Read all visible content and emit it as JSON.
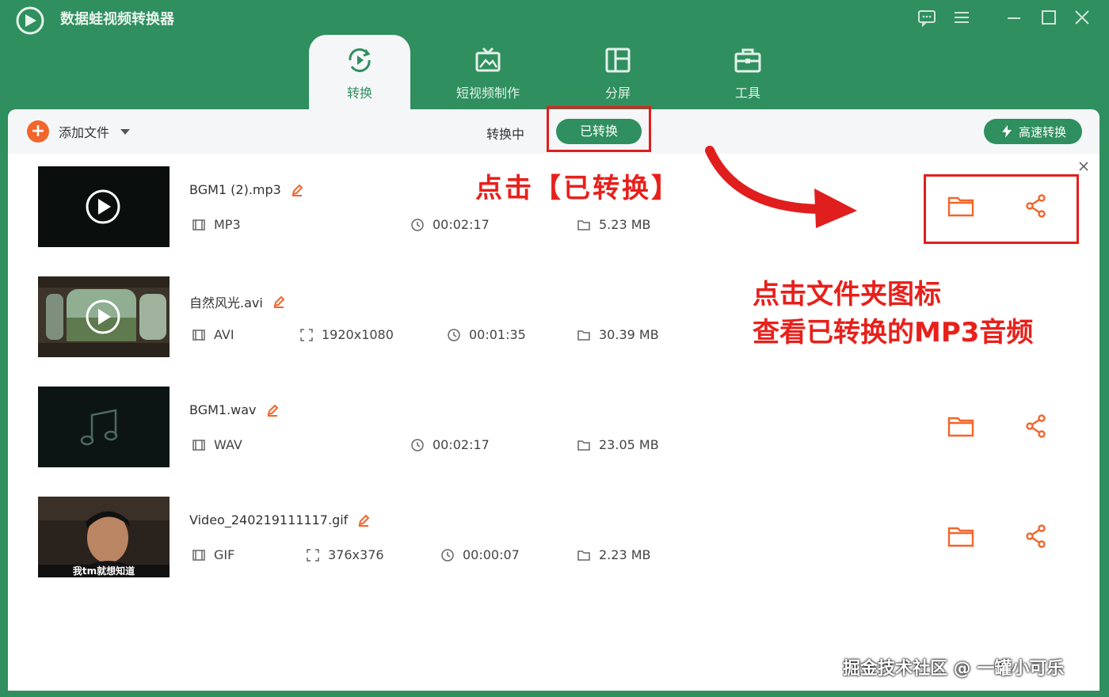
{
  "app": {
    "title": "数据蛙视频转换器"
  },
  "nav": {
    "tabs": [
      {
        "label": "转换",
        "icon": "convert-icon",
        "active": true
      },
      {
        "label": "短视频制作",
        "icon": "tv-icon",
        "active": false
      },
      {
        "label": "分屏",
        "icon": "split-screen-icon",
        "active": false
      },
      {
        "label": "工具",
        "icon": "toolbox-icon",
        "active": false
      }
    ]
  },
  "toolbar": {
    "add_file": "添加文件",
    "sub_tabs": {
      "converting": "转换中",
      "converted": "已转换"
    },
    "fast_convert": "高速转换"
  },
  "files": [
    {
      "name": "BGM1 (2).mp3",
      "format": "MP3",
      "resolution": "",
      "duration": "00:02:17",
      "size": "5.23 MB",
      "thumb": "play"
    },
    {
      "name": "自然风光.avi",
      "format": "AVI",
      "resolution": "1920x1080",
      "duration": "00:01:35",
      "size": "30.39 MB",
      "thumb": "scenery"
    },
    {
      "name": "BGM1.wav",
      "format": "WAV",
      "resolution": "",
      "duration": "00:02:17",
      "size": "23.05 MB",
      "thumb": "music-note"
    },
    {
      "name": "Video_240219111117.gif",
      "format": "GIF",
      "resolution": "376x376",
      "duration": "00:00:07",
      "size": "2.23 MB",
      "thumb": "person"
    }
  ],
  "annotations": {
    "click_converted": "点击【已转换】",
    "click_folder_line1": "点击文件夹图标",
    "click_folder_line2": "查看已转换的MP3音频"
  },
  "thumb_caption": "我tm就想知道",
  "watermark": "掘金技术社区 @ 一罐小可乐",
  "colors": {
    "brand": "#2f8f5e",
    "accent": "#f2652b",
    "annotation": "#e8201b"
  }
}
